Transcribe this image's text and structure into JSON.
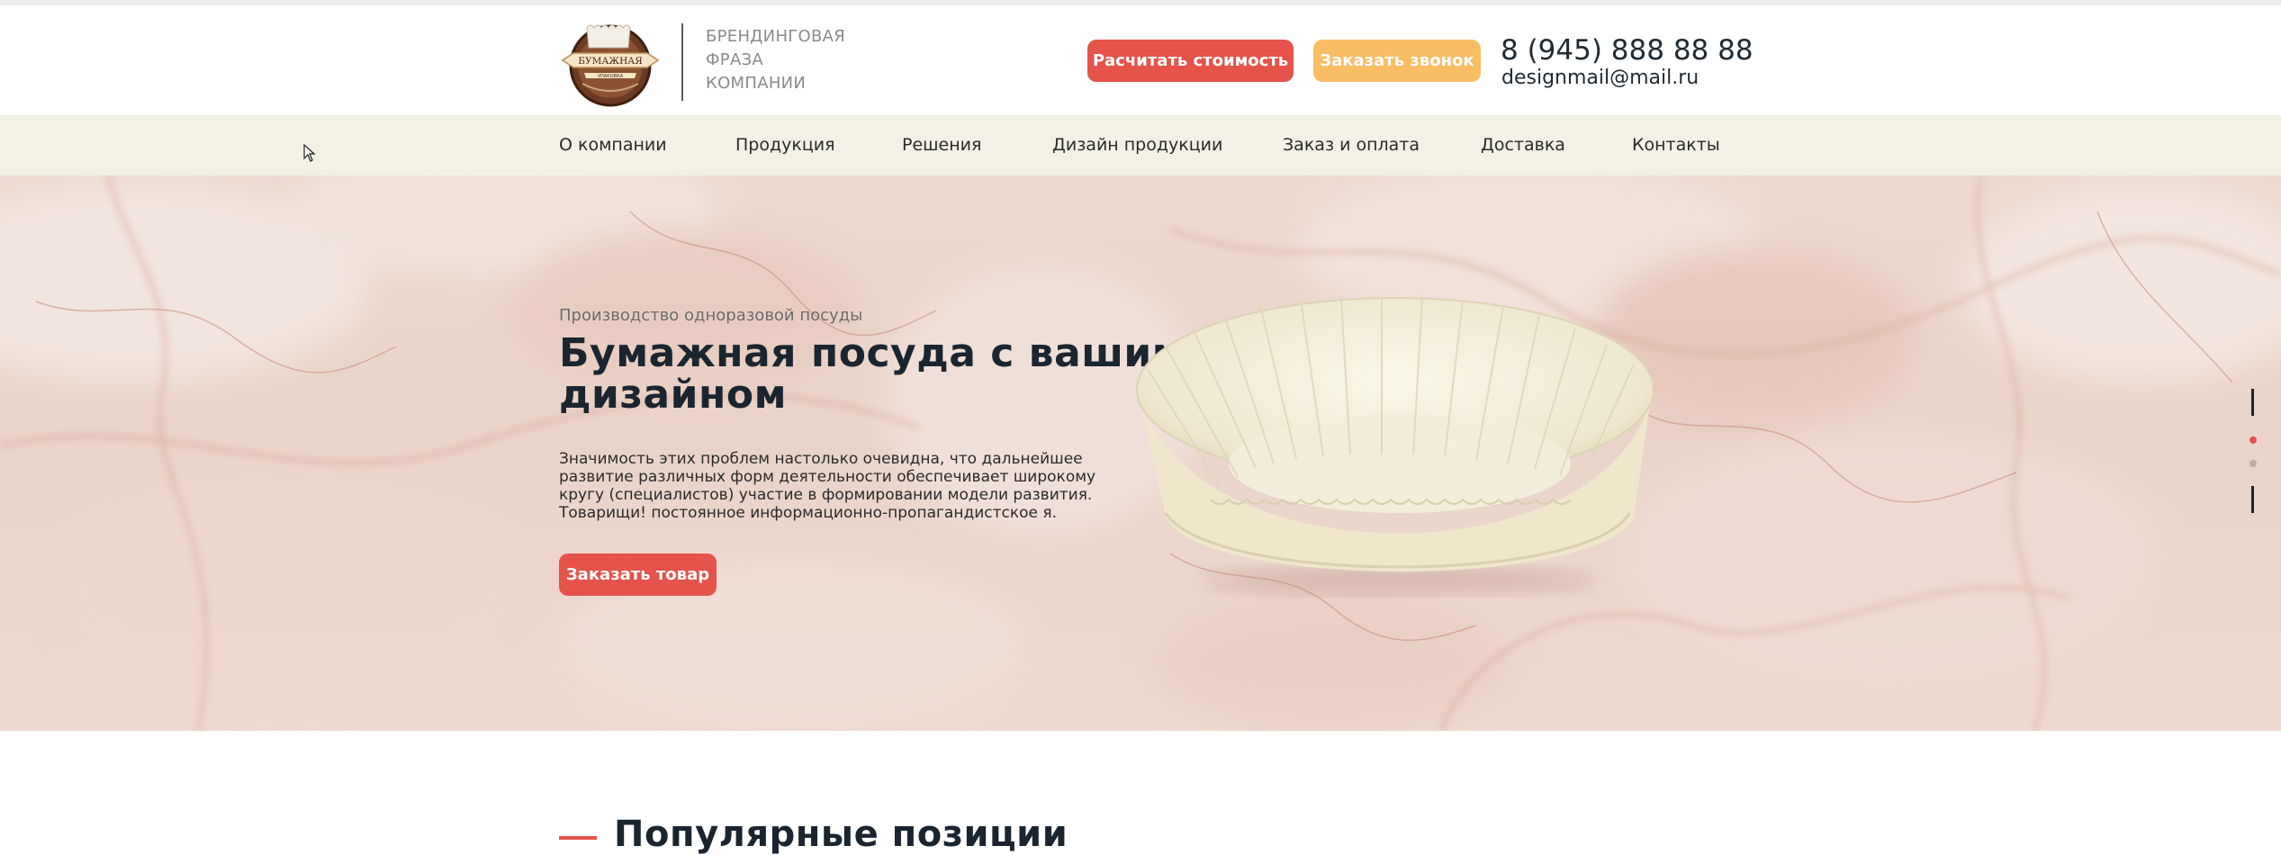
{
  "header": {
    "logo": {
      "line1": "БУМАЖНАЯ",
      "line2": "УПАКОВКА"
    },
    "tagline": [
      "БРЕНДИНГОВАЯ",
      "ФРАЗА",
      "КОМПАНИИ"
    ],
    "calc_button": "Расчитать стоимость",
    "call_button": "Заказать звонок",
    "phone": "8 (945) 888 88 88",
    "email": "designmail@mail.ru"
  },
  "nav": {
    "items": [
      "О компании",
      "Продукция",
      "Решения",
      "Дизайн продукции",
      "Заказ и оплата",
      "Доставка",
      "Контакты"
    ]
  },
  "hero": {
    "subtitle": "Производство одноразовой посуды",
    "title": "Бумажная посуда с вашим дизайном",
    "text": "Значимость этих проблем настолько очевидна, что дальнейшее развитие различных форм деятельности обеспечивает широкому кругу (специалистов) участие в формировании модели развития. Товарищи! постоянное информационно-пропагандистское я.",
    "order_button": "Заказать товар",
    "slider": {
      "total": 2,
      "active": 1
    }
  },
  "section": {
    "title": "Популярные позиции"
  },
  "colors": {
    "accent_red": "#e5534b",
    "accent_yellow": "#f9bd63",
    "nav_bg": "#f3f1e5",
    "text_dark": "#1b2530"
  },
  "icons": {
    "cursor": "arrow-cursor-icon",
    "logo": "cupcake-logo-icon"
  }
}
